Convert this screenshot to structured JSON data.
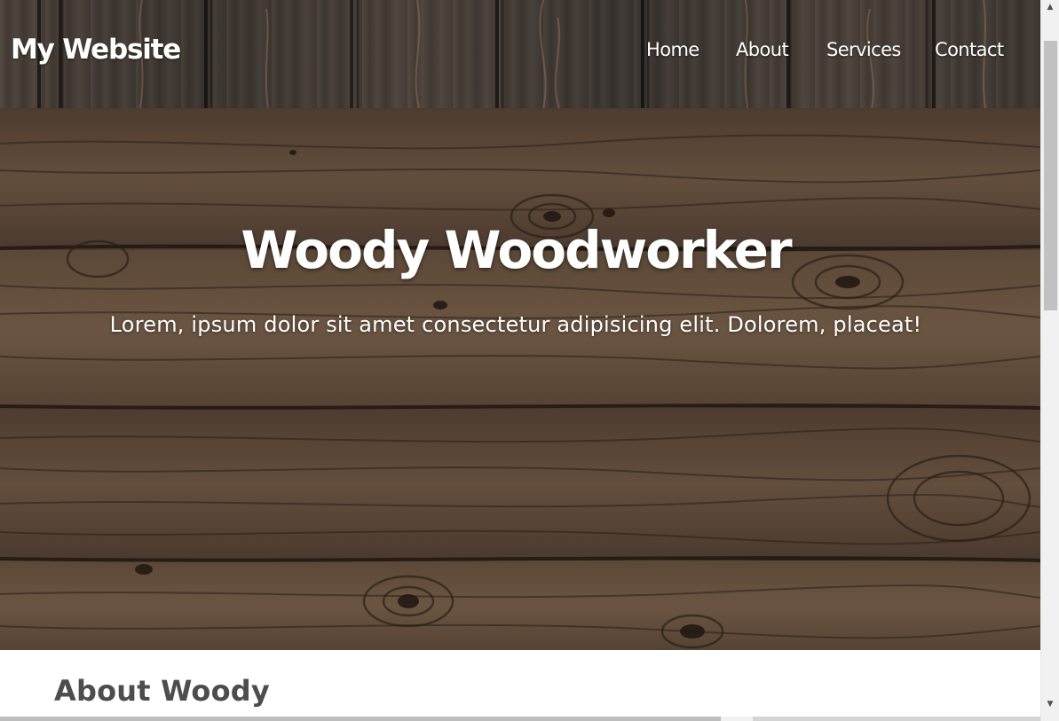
{
  "header": {
    "logo": "My Website",
    "nav": [
      {
        "label": "Home"
      },
      {
        "label": "About"
      },
      {
        "label": "Services"
      },
      {
        "label": "Contact"
      }
    ]
  },
  "hero": {
    "title": "Woody Woodworker",
    "subtitle": "Lorem, ipsum dolor sit amet consectetur adipisicing elit. Dolorem, placeat!"
  },
  "about": {
    "heading": "About Woody"
  },
  "colors": {
    "header_wood": "#3f3832",
    "hero_wood": "#5a4738",
    "text_light": "#ffffff",
    "heading_dark": "#4d4d4d"
  }
}
